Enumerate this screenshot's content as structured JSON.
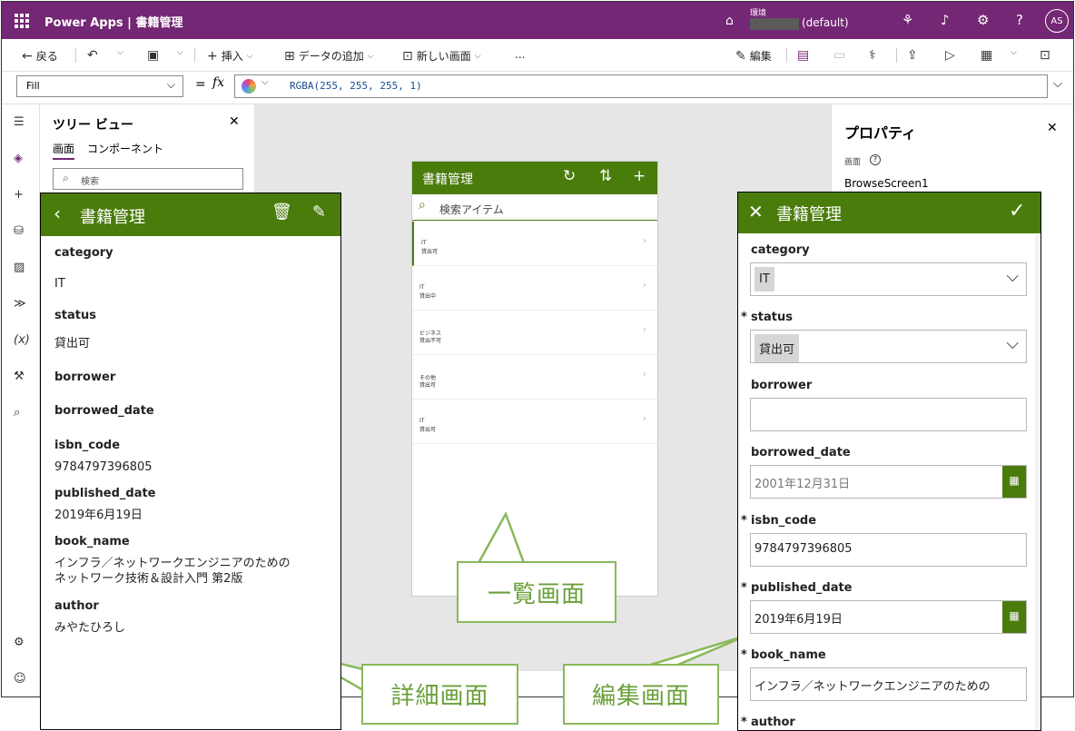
{
  "app": {
    "brand": "Power Apps",
    "separator": "|",
    "title": "書籍管理"
  },
  "environment": {
    "label": "環境",
    "name": "(default)"
  },
  "user": {
    "initials": "AS"
  },
  "toolbar": {
    "back": "戻る",
    "insert": "挿入",
    "add_data": "データの追加",
    "new_screen": "新しい画面",
    "more": "...",
    "edit": "編集"
  },
  "formula": {
    "property": "Fill",
    "equals": "=",
    "fx": "fx",
    "expression": "RGBA(255, 255, 255, 1)"
  },
  "tree_view": {
    "title": "ツリー ビュー",
    "tab_screens": "画面",
    "tab_components": "コンポーネント",
    "search_placeholder": "検索"
  },
  "properties": {
    "title": "プロパティ",
    "kind": "画面",
    "screen_name": "BrowseScreen1"
  },
  "list_screen": {
    "title": "書籍管理",
    "search_placeholder": "検索アイテム",
    "items": [
      {
        "category": "IT",
        "status": "貸出可"
      },
      {
        "category": "IT",
        "status": "貸出中"
      },
      {
        "category": "ビジネス",
        "status": "貸出不可"
      },
      {
        "category": "その他",
        "status": "貸出可"
      },
      {
        "category": "IT",
        "status": "貸出可"
      }
    ]
  },
  "detail_screen": {
    "title": "書籍管理",
    "fields": [
      {
        "label": "category",
        "value": "IT"
      },
      {
        "label": "status",
        "value": "貸出可"
      },
      {
        "label": "borrower",
        "value": ""
      },
      {
        "label": "borrowed_date",
        "value": ""
      },
      {
        "label": "isbn_code",
        "value": "9784797396805"
      },
      {
        "label": "published_date",
        "value": "2019年6月19日"
      },
      {
        "label": "book_name",
        "value_line1": "インフラ／ネットワークエンジニアのための",
        "value_line2": "ネットワーク技術＆設計入門 第2版"
      },
      {
        "label": "author",
        "value": "みやたひろし"
      }
    ]
  },
  "edit_screen": {
    "title": "書籍管理",
    "required_mark": "*",
    "category": {
      "label": "category",
      "value": "IT"
    },
    "status": {
      "label": "status",
      "value": "貸出可"
    },
    "borrower": {
      "label": "borrower",
      "value": ""
    },
    "borrowed_date": {
      "label": "borrowed_date",
      "value": "2001年12月31日"
    },
    "isbn_code": {
      "label": "isbn_code",
      "value": "9784797396805"
    },
    "published_date": {
      "label": "published_date",
      "value": "2019年6月19日"
    },
    "book_name": {
      "label": "book_name",
      "value": "インフラ／ネットワークエンジニアのための"
    },
    "author": {
      "label": "author"
    }
  },
  "callouts": {
    "list": "一覧画面",
    "detail": "詳細画面",
    "edit": "編集画面"
  },
  "colors": {
    "header_purple": "#742774",
    "app_green": "#4a7c0c",
    "callout_green": "#8ab85a"
  }
}
